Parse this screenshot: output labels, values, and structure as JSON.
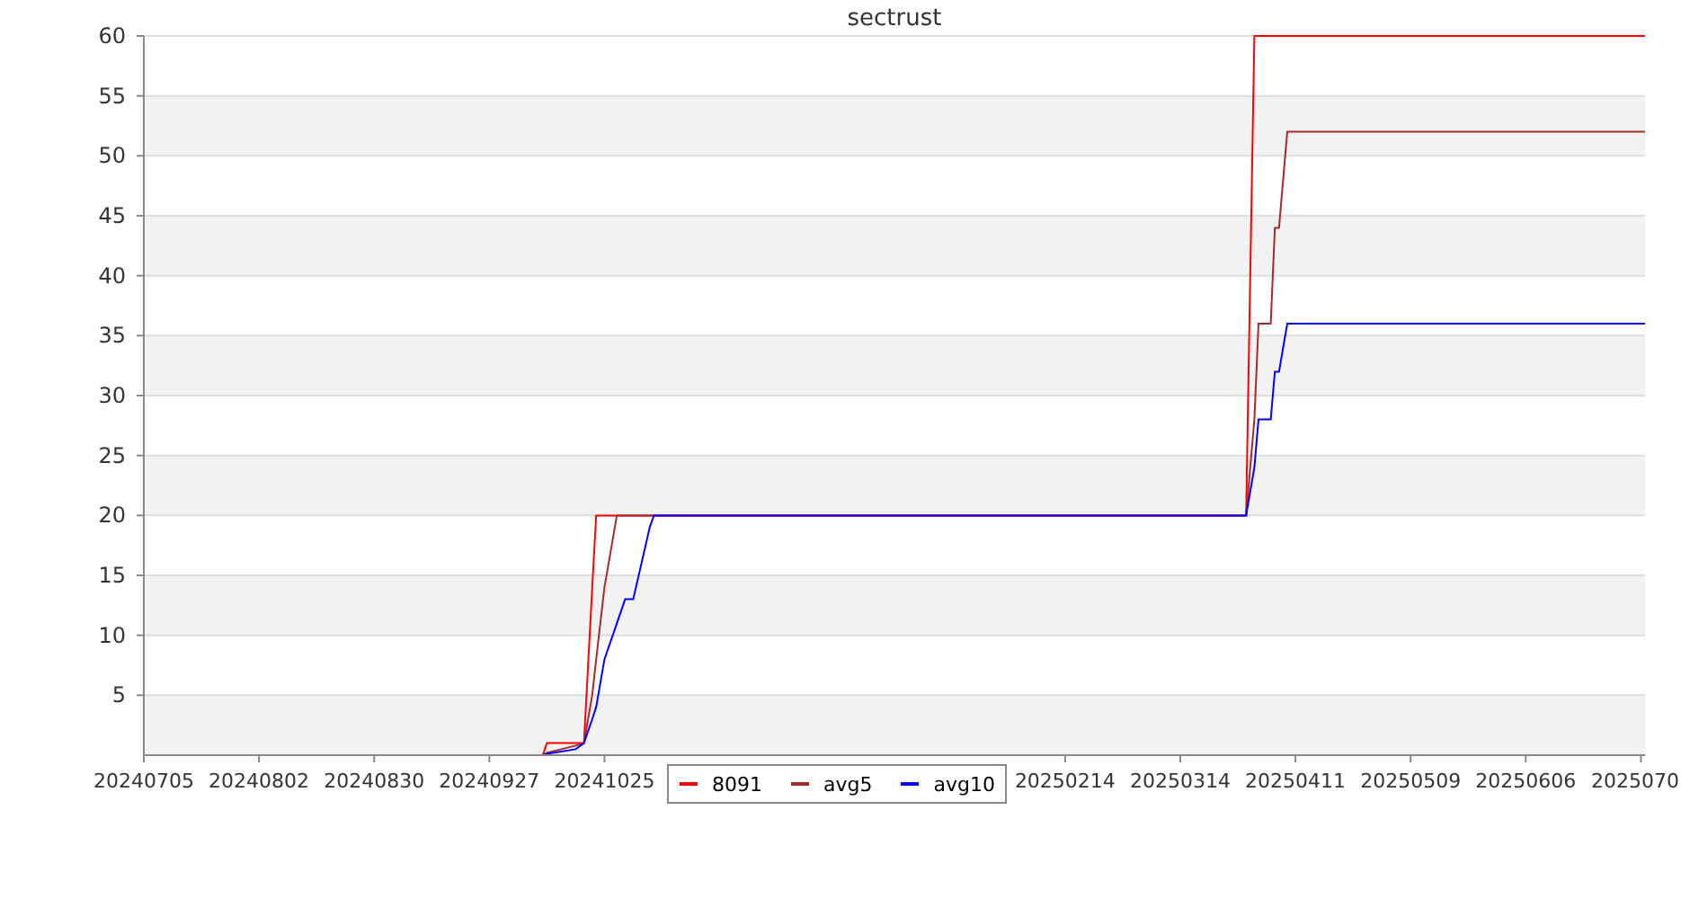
{
  "chart_data": {
    "type": "line",
    "title": "sectrust",
    "x": [
      "2024-10-10",
      "2024-10-11",
      "2024-10-18",
      "2024-10-20",
      "2024-10-22",
      "2024-10-23",
      "2024-10-25",
      "2024-10-28",
      "2024-10-30",
      "2024-11-01",
      "2024-11-05",
      "2024-11-06",
      "2025-03-30",
      "2025-04-01",
      "2025-04-02",
      "2025-04-04",
      "2025-04-05",
      "2025-04-06",
      "2025-04-07",
      "2025-04-09",
      "2025-07-05"
    ],
    "xlim": [
      "2024-07-05",
      "2025-07-05"
    ],
    "ylim": [
      0,
      60
    ],
    "grid": true,
    "xticks": [
      {
        "value": "2024-07-05",
        "label": "20240705"
      },
      {
        "value": "2024-08-02",
        "label": "20240802"
      },
      {
        "value": "2024-08-30",
        "label": "20240830"
      },
      {
        "value": "2024-09-27",
        "label": "20240927"
      },
      {
        "value": "2024-10-25",
        "label": "20241025"
      },
      {
        "value": "2025-02-14",
        "label": "20250214"
      },
      {
        "value": "2025-03-14",
        "label": "20250314"
      },
      {
        "value": "2025-04-11",
        "label": "20250411"
      },
      {
        "value": "2025-05-09",
        "label": "20250509"
      },
      {
        "value": "2025-06-06",
        "label": "20250606"
      },
      {
        "value": "2025-07-04",
        "label": "2025070"
      }
    ],
    "yticks": [
      5,
      10,
      15,
      20,
      25,
      30,
      35,
      40,
      45,
      50,
      55,
      60
    ],
    "series": [
      {
        "name": "8091",
        "color": "#ff0000",
        "values": [
          0,
          1,
          1,
          1,
          14,
          20,
          20,
          20,
          20,
          20,
          20,
          20,
          20,
          60,
          60,
          60,
          60,
          60,
          60,
          60,
          60
        ]
      },
      {
        "name": "avg5",
        "color": "#a52a2a",
        "values": [
          0,
          0.2,
          0.8,
          1,
          5,
          8,
          14,
          20,
          20,
          20,
          20,
          20,
          20,
          28,
          36,
          36,
          36,
          44,
          44,
          52,
          52
        ]
      },
      {
        "name": "avg10",
        "color": "#0000ff",
        "values": [
          0,
          0.1,
          0.5,
          1,
          3,
          4,
          8,
          11,
          13,
          13,
          19,
          20,
          20,
          24,
          28,
          28,
          28,
          32,
          32,
          36,
          36
        ]
      }
    ]
  }
}
